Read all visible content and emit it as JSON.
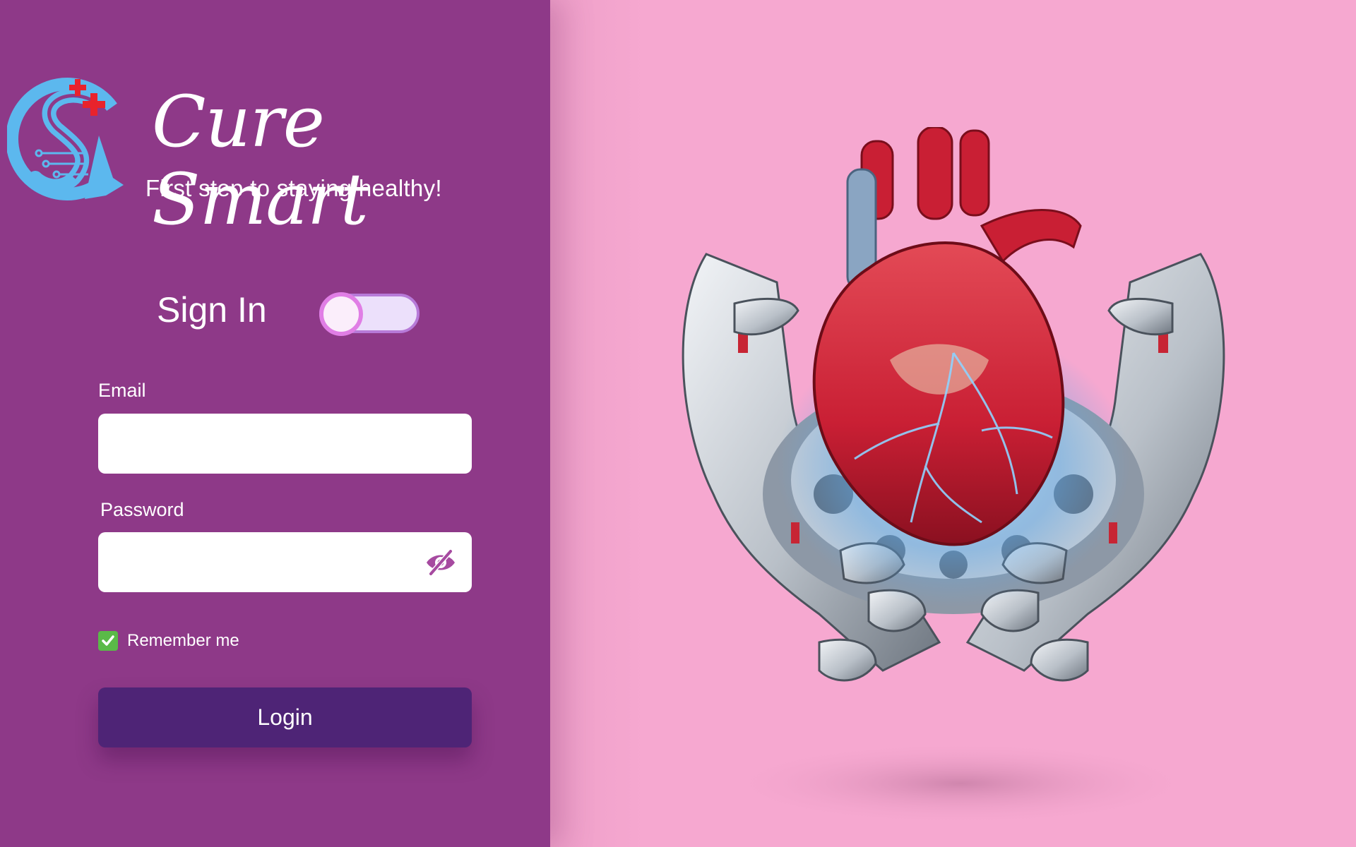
{
  "brand": {
    "name": "Cure Smart",
    "tagline": "First step to staying healthy!",
    "colors": {
      "panel": "#8e3988",
      "background": "#f6a8d0",
      "button": "#4e2476",
      "logo": "#5cb8ee"
    }
  },
  "signin": {
    "title": "Sign In",
    "toggle_on": false
  },
  "form": {
    "email_label": "Email",
    "email_value": "",
    "email_placeholder": "",
    "password_label": "Password",
    "password_value": "",
    "password_placeholder": "",
    "password_visibility_icon": "eye-off-icon",
    "remember_label": "Remember me",
    "remember_checked": true,
    "login_label": "Login"
  },
  "hero": {
    "image": "robot-hands-holding-heart"
  }
}
